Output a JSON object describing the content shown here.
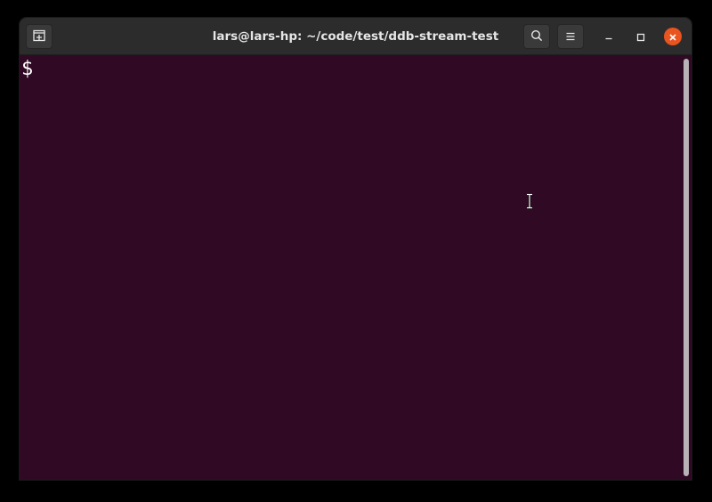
{
  "window": {
    "title": "lars@lars-hp: ~/code/test/ddb-stream-test"
  },
  "titlebar": {
    "buttons": [
      {
        "name": "new-tab",
        "icon": "new-tab-icon"
      },
      {
        "name": "search",
        "icon": "search-icon"
      },
      {
        "name": "menu",
        "icon": "hamburger-menu-icon"
      }
    ],
    "controls": [
      {
        "name": "minimize",
        "icon": "minimize-icon"
      },
      {
        "name": "maximize",
        "icon": "maximize-icon"
      },
      {
        "name": "close",
        "icon": "close-icon"
      }
    ]
  },
  "terminal": {
    "prompt": "$",
    "background_color": "#300a24",
    "text_color": "#ffffff"
  },
  "colors": {
    "titlebar": "#2c2c2c",
    "close_button": "#e95420",
    "title_text": "#e6e6e6"
  }
}
